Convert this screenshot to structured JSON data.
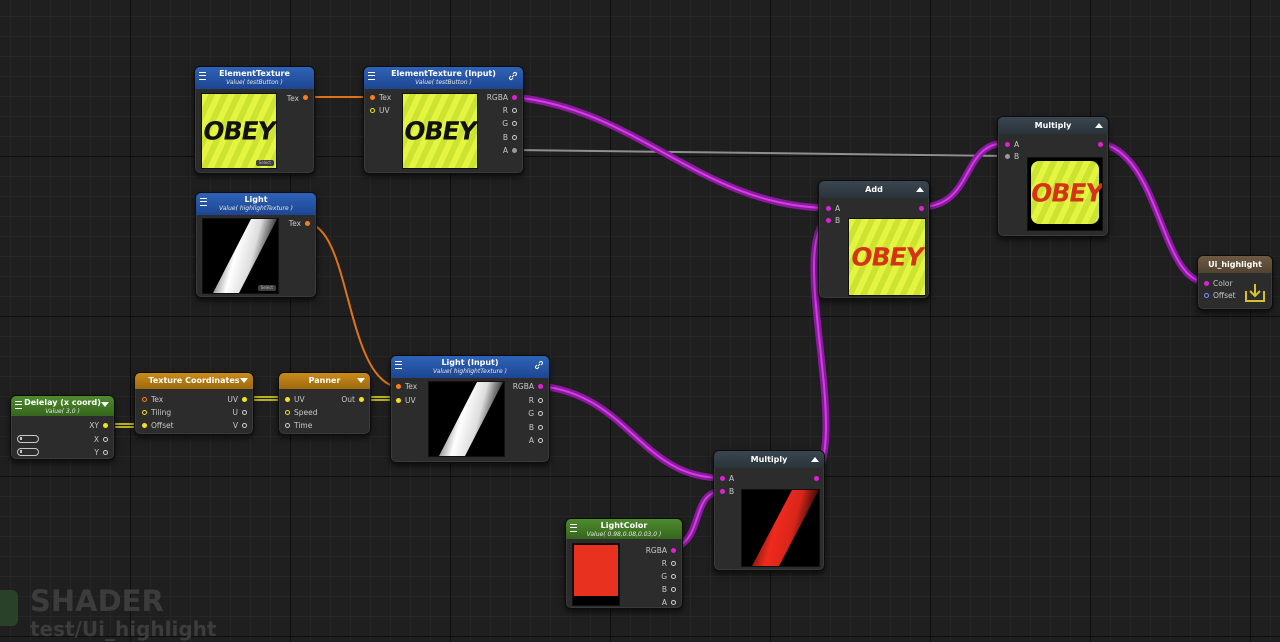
{
  "nodes": {
    "element_texture": {
      "title": "ElementTexture",
      "value": "Value( testButton )",
      "port_tex": "Tex",
      "preview_text": "OBEY",
      "select": "Select"
    },
    "element_texture_input": {
      "title": "ElementTexture (Input)",
      "value": "Value( testButton )",
      "in": [
        "Tex",
        "UV"
      ],
      "out": [
        "RGBA",
        "R",
        "G",
        "B",
        "A"
      ],
      "preview_text": "OBEY"
    },
    "light": {
      "title": "Light",
      "value": "Value( highlightTexture )",
      "port_tex": "Tex",
      "select": "Select"
    },
    "light_input": {
      "title": "Light (Input)",
      "value": "Value( highlightTexture )",
      "in": [
        "Tex",
        "UV"
      ],
      "out": [
        "RGBA",
        "R",
        "G",
        "B",
        "A"
      ]
    },
    "add": {
      "title": "Add",
      "in": [
        "A",
        "B"
      ],
      "preview_text": "OBEY"
    },
    "multiply_top": {
      "title": "Multiply",
      "in": [
        "A",
        "B"
      ],
      "preview_text": "OBEY"
    },
    "ui_highlight": {
      "title": "Ui_highlight",
      "in": [
        "Color",
        "Offset"
      ]
    },
    "texture_coordinates": {
      "title": "Texture Coordinates",
      "in": [
        "Tex",
        "Tiling",
        "Offset"
      ],
      "out": [
        "UV",
        "U",
        "V"
      ]
    },
    "panner": {
      "title": "Panner",
      "in": [
        "UV",
        "Speed",
        "Time"
      ],
      "out": "Out"
    },
    "delelay": {
      "title": "Delelay (x coord)",
      "value": "Value( 3,0 )",
      "out": [
        "XY",
        "X",
        "Y"
      ],
      "field_x": "1",
      "field_y": "0"
    },
    "multiply_bottom": {
      "title": "Multiply",
      "in": [
        "A",
        "B"
      ]
    },
    "light_color": {
      "title": "LightColor",
      "value": "Value( 0.98,0.08,0.03,0 )",
      "out": [
        "RGBA",
        "R",
        "G",
        "B",
        "A"
      ],
      "swatch": "#e8321f"
    }
  },
  "watermark": {
    "line1": "SHADER",
    "line2": "test/Ui_highlight"
  },
  "colors": {
    "wire_texture": "#ff7d1a",
    "wire_color": "#b020c0",
    "wire_vector": "#e8e020",
    "wire_scalar": "#9a9a9a"
  }
}
